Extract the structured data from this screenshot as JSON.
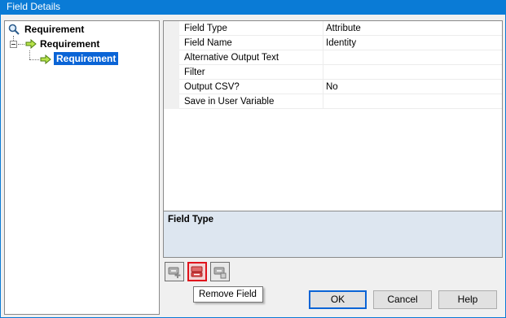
{
  "window": {
    "title": "Field Details"
  },
  "tree": {
    "root": {
      "label": "Requirement",
      "icon": "magnifier-icon"
    },
    "child": {
      "label": "Requirement",
      "icon": "green-arrow-icon"
    },
    "grandchild": {
      "label": "Requirement",
      "icon": "green-arrow-icon",
      "selected": true
    }
  },
  "properties": [
    {
      "key": "Field Type",
      "value": "Attribute"
    },
    {
      "key": "Field Name",
      "value": "Identity"
    },
    {
      "key": "Alternative Output Text",
      "value": ""
    },
    {
      "key": "Filter",
      "value": ""
    },
    {
      "key": "Output CSV?",
      "value": "No"
    },
    {
      "key": "Save in User Variable",
      "value": ""
    }
  ],
  "description": {
    "title": "Field Type"
  },
  "toolbar": {
    "add_icon": "add-field-icon",
    "remove_icon": "remove-field-icon",
    "edit_icon": "edit-field-icon",
    "tooltip": "Remove Field"
  },
  "buttons": {
    "ok": "OK",
    "cancel": "Cancel",
    "help": "Help"
  },
  "colors": {
    "accent": "#0a7bd6",
    "selection": "#0a64d6",
    "active_outline": "#e0121b",
    "description_bg": "#dde6f0"
  }
}
